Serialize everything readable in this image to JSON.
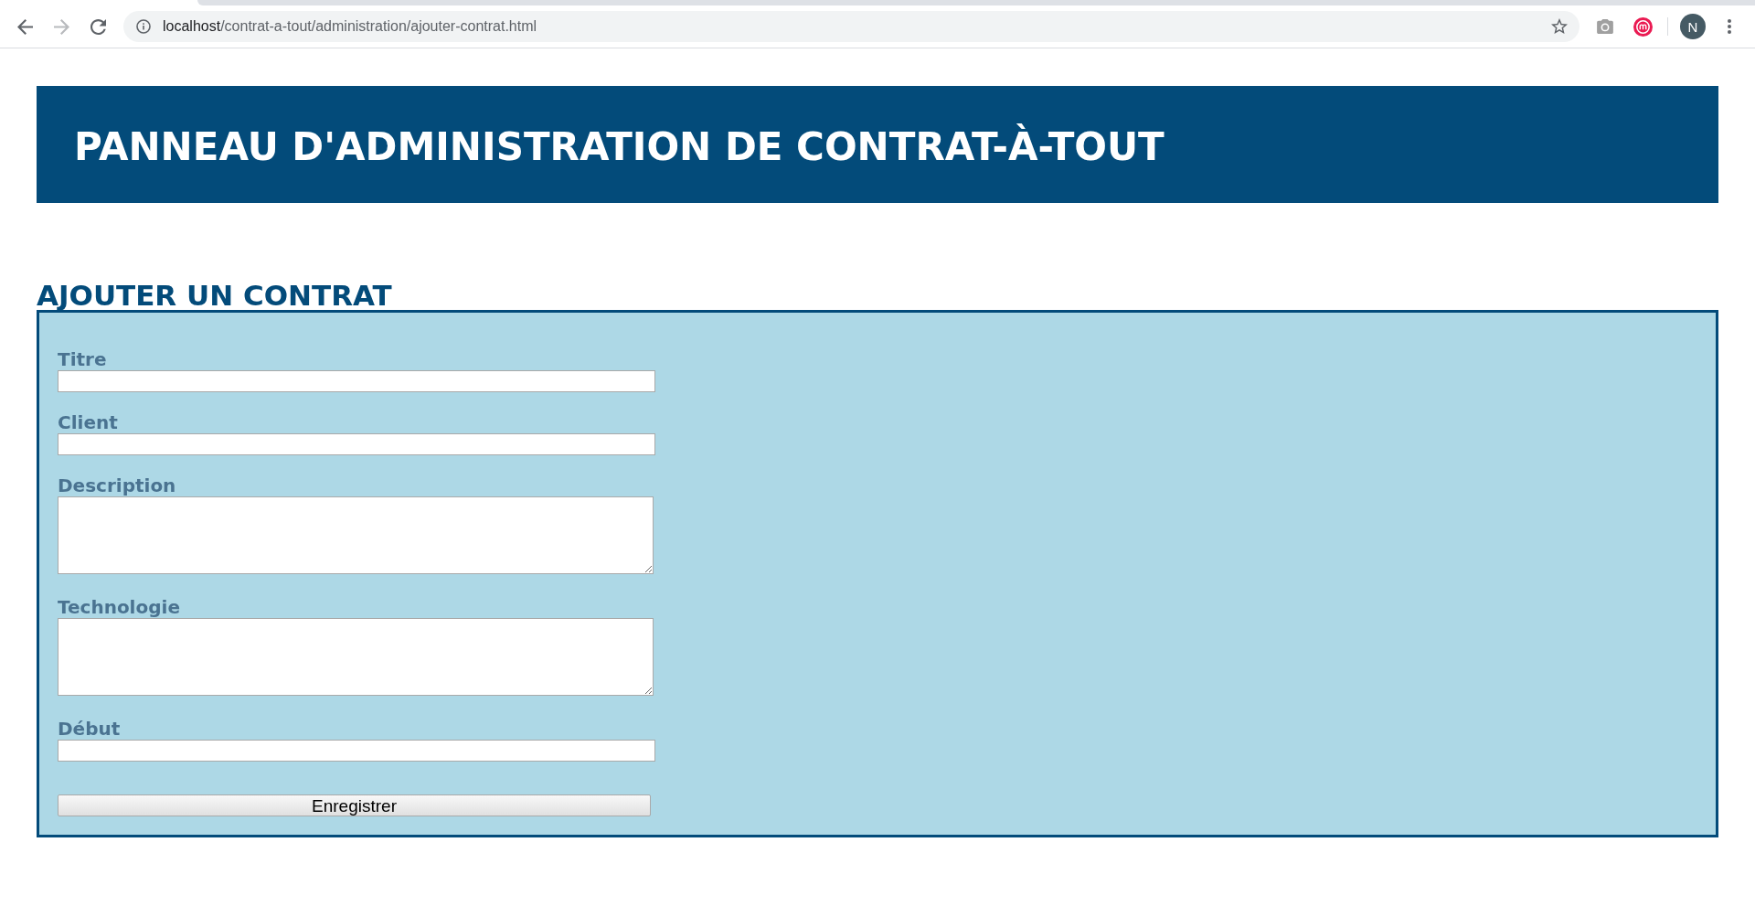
{
  "browser": {
    "nav_buttons": [
      {
        "kind": "back",
        "disabled": false
      },
      {
        "kind": "forward",
        "disabled": true
      },
      {
        "kind": "reload",
        "disabled": false
      }
    ],
    "address_bar": {
      "host": "localhost",
      "path": "/contrat-a-tout/administration/ajouter-contrat.html",
      "bookmarked": false
    },
    "extensions": [
      {
        "kind": "camera"
      },
      {
        "kind": "logo"
      }
    ],
    "profile": {
      "initial": "N"
    }
  },
  "header": {
    "title": "PANNEAU D'ADMINISTRATION DE CONTRAT-À-TOUT"
  },
  "section": {
    "heading": "AJOUTER UN CONTRAT",
    "form": {
      "fields": [
        {
          "label": "Titre",
          "kind": "input"
        },
        {
          "label": "Client",
          "kind": "input"
        },
        {
          "label": "Description",
          "kind": "textarea"
        },
        {
          "label": "Technologie",
          "kind": "textarea"
        },
        {
          "label": "Début",
          "kind": "input"
        }
      ],
      "submit": "Enregistrer"
    }
  }
}
